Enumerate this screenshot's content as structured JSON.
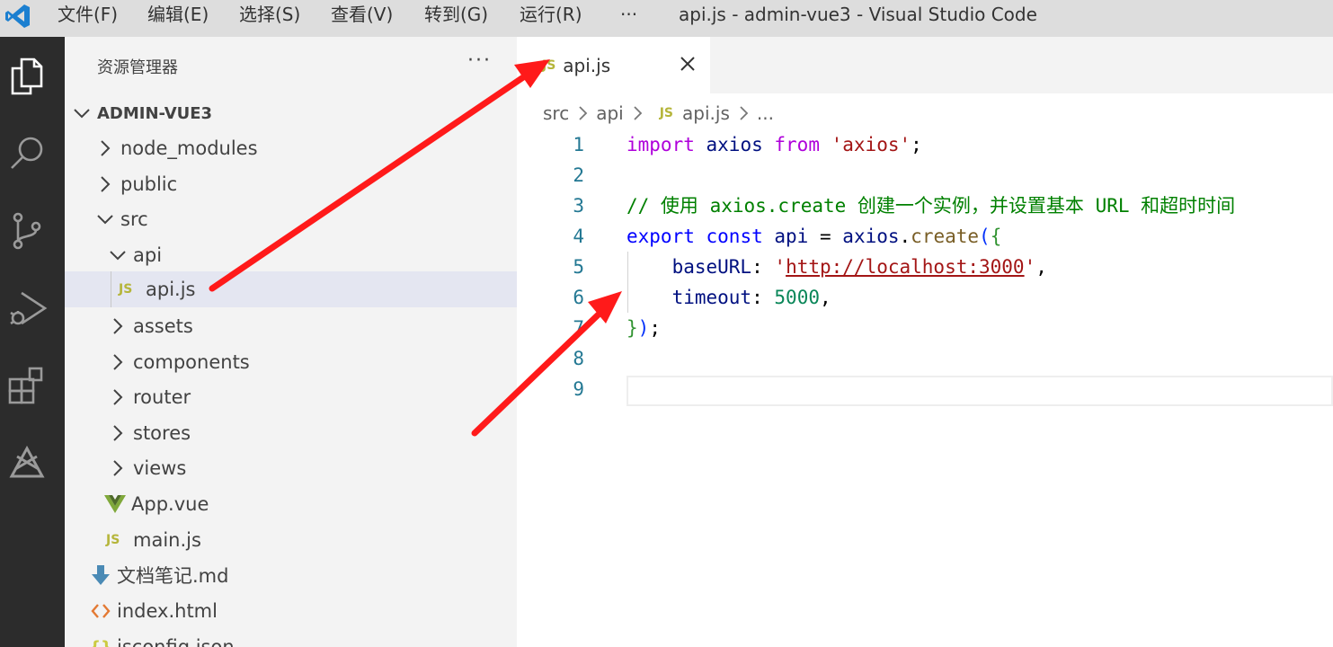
{
  "titlebar": {
    "menus": [
      "文件(F)",
      "编辑(E)",
      "选择(S)",
      "查看(V)",
      "转到(G)",
      "运行(R)",
      "···"
    ],
    "window_title": "api.js - admin-vue3 - Visual Studio Code"
  },
  "activity_bar": {
    "icons": [
      "explorer-icon",
      "search-icon",
      "source-control-icon",
      "run-debug-icon",
      "extensions-icon",
      "extra-icon"
    ]
  },
  "sidebar": {
    "title": "资源管理器",
    "more": "···",
    "project": "ADMIN-VUE3",
    "tree": [
      {
        "label": "node_modules",
        "type": "folder",
        "expanded": false
      },
      {
        "label": "public",
        "type": "folder",
        "expanded": false
      },
      {
        "label": "src",
        "type": "folder",
        "expanded": true
      },
      {
        "label": "api",
        "type": "folder",
        "expanded": true
      },
      {
        "label": "api.js",
        "type": "js",
        "icon_text": "JS",
        "selected": true
      },
      {
        "label": "assets",
        "type": "folder",
        "expanded": false
      },
      {
        "label": "components",
        "type": "folder",
        "expanded": false
      },
      {
        "label": "router",
        "type": "folder",
        "expanded": false
      },
      {
        "label": "stores",
        "type": "folder",
        "expanded": false
      },
      {
        "label": "views",
        "type": "folder",
        "expanded": false
      },
      {
        "label": "App.vue",
        "type": "vue"
      },
      {
        "label": "main.js",
        "type": "js",
        "icon_text": "JS"
      },
      {
        "label": "文档笔记.md",
        "type": "md"
      },
      {
        "label": "index.html",
        "type": "html"
      },
      {
        "label": "jsconfig.json",
        "type": "json"
      }
    ]
  },
  "editor": {
    "tab": {
      "icon_text": "JS",
      "label": "api.js"
    },
    "breadcrumb": {
      "parts": [
        "src",
        "api"
      ],
      "file_icon": "JS",
      "file": "api.js",
      "more": "..."
    },
    "line_numbers": [
      "1",
      "2",
      "3",
      "4",
      "5",
      "6",
      "7",
      "8",
      "9"
    ],
    "code": {
      "l1": {
        "import": "import",
        "axios": "axios",
        "from": "from",
        "str": "'axios'",
        "semi": ";"
      },
      "l3": {
        "comment": "// 使用 axios.create 创建一个实例，并设置基本 URL 和超时时间"
      },
      "l4": {
        "export": "export",
        "const": "const",
        "api": "api",
        "eq": "=",
        "obj": "axios",
        "dot": ".",
        "fn": "create",
        "paren": "(",
        "brace": "{"
      },
      "l5": {
        "key": "baseURL",
        "colon": ":",
        "q1": "'",
        "url": "http://localhost:3000",
        "q2": "'",
        "comma": ","
      },
      "l6": {
        "key": "timeout",
        "colon": ":",
        "num": "5000",
        "comma": ","
      },
      "l7": {
        "brace": "}",
        "paren": ")",
        "semi": ";"
      }
    }
  },
  "colors": {
    "annotation_arrow": "#ff1a1a",
    "activity_bar": "#2c2c2c",
    "sidebar": "#f3f3f3",
    "selection": "#e4e6f1",
    "js_icon": "#b5b53a"
  }
}
